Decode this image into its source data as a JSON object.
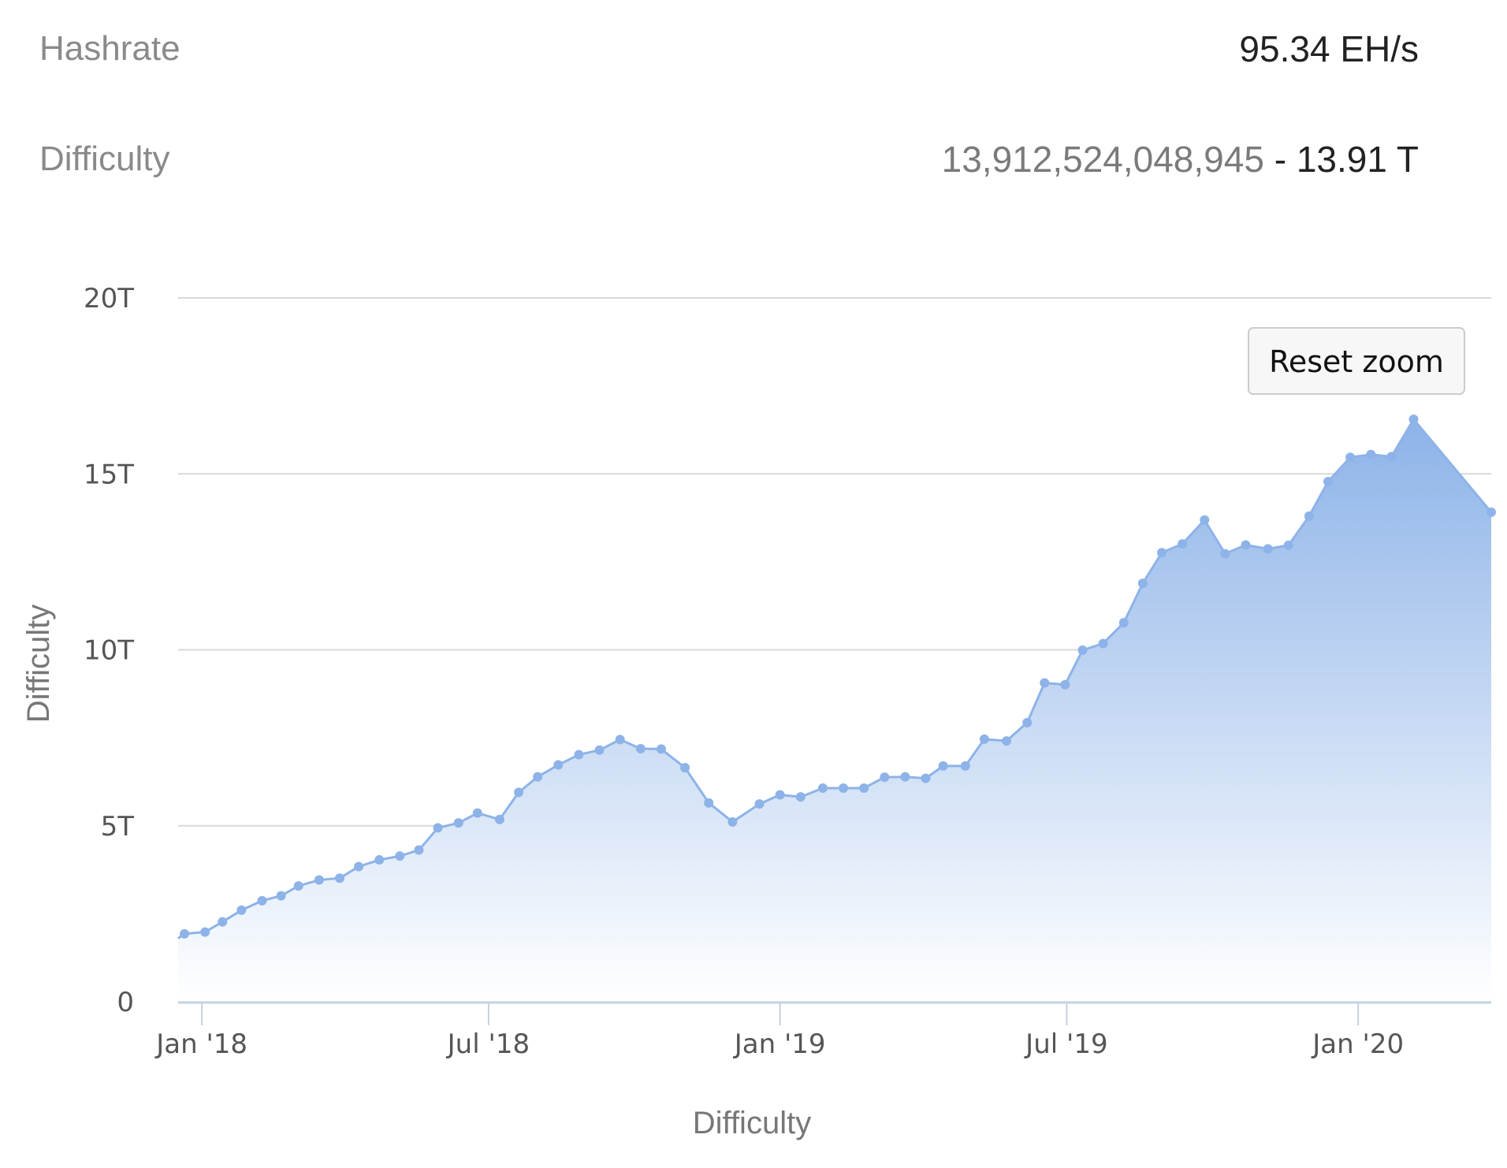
{
  "stats": {
    "hashrate": {
      "label": "Hashrate",
      "value": "95.34 EH/s"
    },
    "difficulty": {
      "label": "Difficulty",
      "raw": "13,912,524,048,945",
      "separator": " - ",
      "value": "13.91 T"
    }
  },
  "reset_zoom_label": "Reset zoom",
  "colors": {
    "line": "#8db3e8",
    "area_top": "#8db3e8",
    "area_bottom": "#ffffff",
    "grid": "#d9d9d9",
    "axis": "#c5d1e0"
  },
  "chart_data": {
    "type": "area",
    "title": "",
    "xlabel": "Difficulty",
    "ylabel": "Difficulty",
    "ylim": [
      0,
      20
    ],
    "y_unit": "T",
    "yticks": [
      {
        "value": 0,
        "label": "0"
      },
      {
        "value": 5,
        "label": "5T"
      },
      {
        "value": 10,
        "label": "10T"
      },
      {
        "value": 15,
        "label": "15T"
      },
      {
        "value": 20,
        "label": "20T"
      }
    ],
    "xlim": [
      "2017-12-17",
      "2020-03-25"
    ],
    "xticks": [
      {
        "date": "2018-01-01",
        "label": "Jan '18"
      },
      {
        "date": "2018-07-01",
        "label": "Jul '18"
      },
      {
        "date": "2019-01-01",
        "label": "Jan '19"
      },
      {
        "date": "2019-07-01",
        "label": "Jul '19"
      },
      {
        "date": "2020-01-01",
        "label": "Jan '20"
      }
    ],
    "grid": true,
    "legend": "none",
    "series": [
      {
        "points": [
          [
            "2017-12-17",
            1.8
          ],
          [
            "2017-12-21",
            1.93
          ],
          [
            "2018-01-03",
            1.98
          ],
          [
            "2018-01-14",
            2.27
          ],
          [
            "2018-01-26",
            2.6
          ],
          [
            "2018-02-08",
            2.87
          ],
          [
            "2018-02-20",
            3.01
          ],
          [
            "2018-03-03",
            3.29
          ],
          [
            "2018-03-16",
            3.46
          ],
          [
            "2018-03-29",
            3.51
          ],
          [
            "2018-04-10",
            3.84
          ],
          [
            "2018-04-23",
            4.03
          ],
          [
            "2018-05-06",
            4.14
          ],
          [
            "2018-05-18",
            4.31
          ],
          [
            "2018-05-30",
            4.94
          ],
          [
            "2018-06-12",
            5.08
          ],
          [
            "2018-06-24",
            5.36
          ],
          [
            "2018-07-08",
            5.18
          ],
          [
            "2018-07-20",
            5.95
          ],
          [
            "2018-08-01",
            6.39
          ],
          [
            "2018-08-14",
            6.73
          ],
          [
            "2018-08-27",
            7.02
          ],
          [
            "2018-09-09",
            7.15
          ],
          [
            "2018-09-22",
            7.45
          ],
          [
            "2018-10-05",
            7.19
          ],
          [
            "2018-10-18",
            7.18
          ],
          [
            "2018-11-02",
            6.65
          ],
          [
            "2018-11-17",
            5.65
          ],
          [
            "2018-12-02",
            5.11
          ],
          [
            "2018-12-19",
            5.62
          ],
          [
            "2019-01-01",
            5.88
          ],
          [
            "2019-01-14",
            5.82
          ],
          [
            "2019-01-28",
            6.07
          ],
          [
            "2019-02-10",
            6.07
          ],
          [
            "2019-02-23",
            6.07
          ],
          [
            "2019-03-08",
            6.38
          ],
          [
            "2019-03-21",
            6.39
          ],
          [
            "2019-04-03",
            6.35
          ],
          [
            "2019-04-14",
            6.7
          ],
          [
            "2019-04-28",
            6.7
          ],
          [
            "2019-05-10",
            7.46
          ],
          [
            "2019-05-24",
            7.41
          ],
          [
            "2019-06-06",
            7.93
          ],
          [
            "2019-06-17",
            9.06
          ],
          [
            "2019-06-30",
            9.01
          ],
          [
            "2019-07-11",
            9.99
          ],
          [
            "2019-07-24",
            10.18
          ],
          [
            "2019-08-06",
            10.77
          ],
          [
            "2019-08-18",
            11.89
          ],
          [
            "2019-08-30",
            12.76
          ],
          [
            "2019-09-12",
            13.01
          ],
          [
            "2019-09-26",
            13.69
          ],
          [
            "2019-10-09",
            12.73
          ],
          [
            "2019-10-22",
            12.98
          ],
          [
            "2019-11-05",
            12.87
          ],
          [
            "2019-11-18",
            12.97
          ],
          [
            "2019-12-01",
            13.8
          ],
          [
            "2019-12-13",
            14.78
          ],
          [
            "2019-12-27",
            15.47
          ],
          [
            "2020-01-09",
            15.55
          ],
          [
            "2020-01-22",
            15.49
          ],
          [
            "2020-02-05",
            16.55
          ],
          [
            "2020-03-25",
            13.91
          ]
        ]
      }
    ]
  }
}
